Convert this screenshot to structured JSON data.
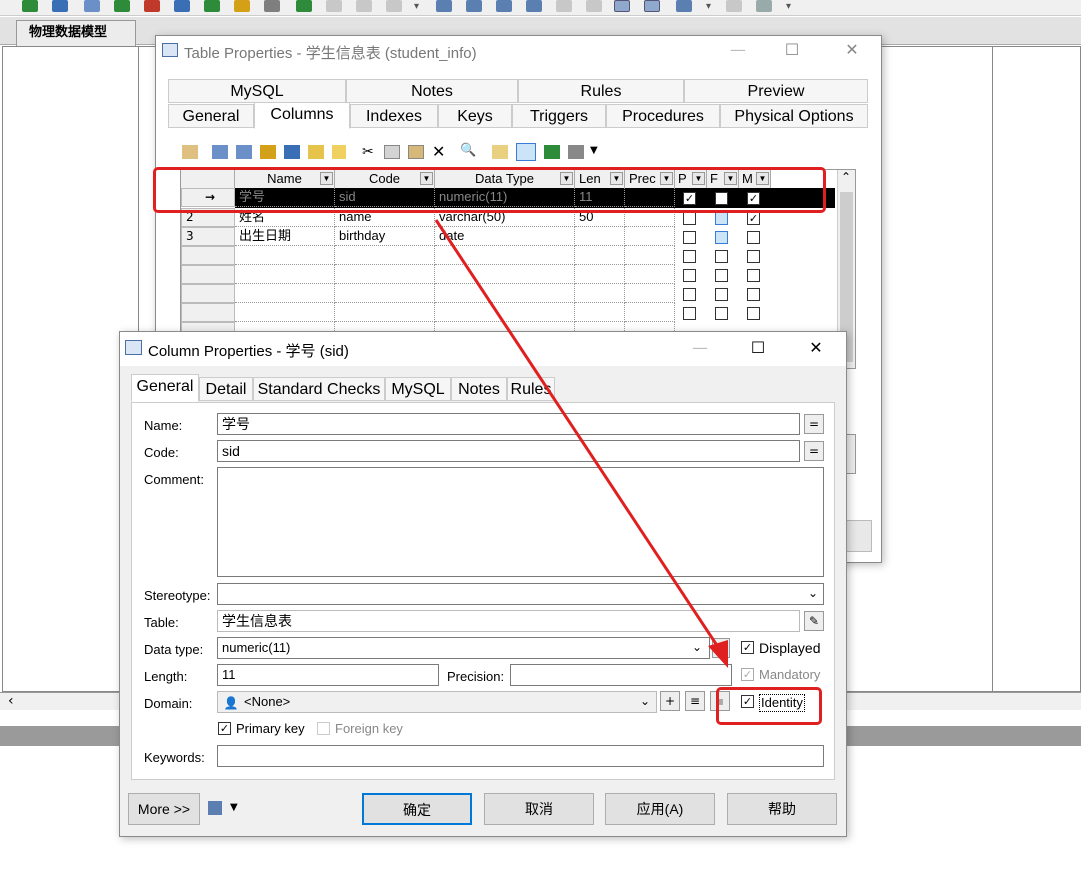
{
  "app": {
    "doc_tab": "物理数据模型"
  },
  "table_properties": {
    "title": "Table Properties - 学生信息表 (student_info)",
    "tabs_row1": [
      "MySQL",
      "Notes",
      "Rules",
      "Preview"
    ],
    "tabs_row2": [
      "General",
      "Columns",
      "Indexes",
      "Keys",
      "Triggers",
      "Procedures",
      "Physical Options"
    ],
    "selected_tab": "Columns",
    "grid_headers": [
      "Name",
      "Code",
      "Data Type",
      "Len",
      "Prec",
      "P",
      "F",
      "M"
    ],
    "rows": [
      {
        "num": "→",
        "name": "学号",
        "code": "sid",
        "dtype": "numeric(11)",
        "len": "11",
        "prec": "",
        "p": true,
        "f": false,
        "m": true
      },
      {
        "num": "2",
        "name": "姓名",
        "code": "name",
        "dtype": "varchar(50)",
        "len": "50",
        "prec": "",
        "p": false,
        "f": false,
        "m": true
      },
      {
        "num": "3",
        "name": "出生日期",
        "code": "birthday",
        "dtype": "date",
        "len": "",
        "prec": "",
        "p": false,
        "f": false,
        "m": false
      }
    ]
  },
  "column_properties": {
    "title": "Column Properties - 学号 (sid)",
    "tabs": [
      "General",
      "Detail",
      "Standard Checks",
      "MySQL",
      "Notes",
      "Rules"
    ],
    "selected_tab": "General",
    "labels": {
      "name": "Name:",
      "code": "Code:",
      "comment": "Comment:",
      "stereotype": "Stereotype:",
      "table": "Table:",
      "data_type": "Data type:",
      "length": "Length:",
      "precision": "Precision:",
      "domain": "Domain:",
      "keywords": "Keywords:"
    },
    "values": {
      "name": "学号",
      "code": "sid",
      "comment": "",
      "stereotype": "",
      "table": "学生信息表",
      "data_type": "numeric(11)",
      "length": "11",
      "precision": "",
      "domain": "<None>",
      "keywords": ""
    },
    "checkboxes": {
      "displayed": {
        "label": "Displayed",
        "checked": true
      },
      "mandatory": {
        "label": "Mandatory",
        "checked": true
      },
      "identity": {
        "label": "Identity",
        "checked": true
      },
      "primary_key": {
        "label": "Primary key",
        "checked": true
      },
      "foreign_key": {
        "label": "Foreign key",
        "checked": false
      }
    },
    "buttons": {
      "more": "More >>",
      "ok": "确定",
      "cancel": "取消",
      "apply": "应用(A)",
      "help": "帮助"
    }
  },
  "colors": {
    "annotation_red": "#e02020",
    "selected_row": "#000000"
  }
}
